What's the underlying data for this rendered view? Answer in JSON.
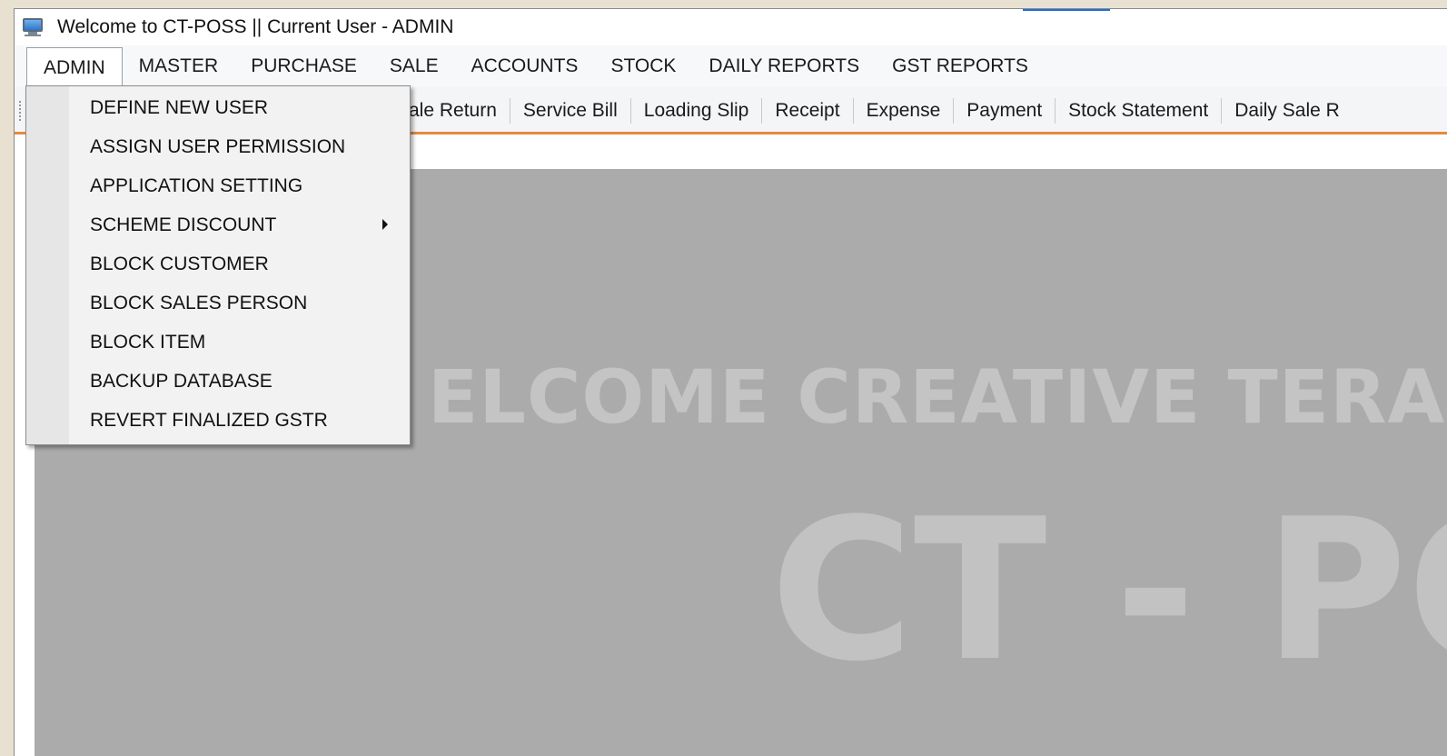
{
  "window": {
    "title": "Welcome to CT-POSS || Current User - ADMIN"
  },
  "menubar": {
    "items": [
      "ADMIN",
      "MASTER",
      "PURCHASE",
      "SALE",
      "ACCOUNTS",
      "STOCK",
      "DAILY REPORTS",
      "GST REPORTS"
    ],
    "active": "ADMIN"
  },
  "toolbar": {
    "items": [
      "ale Return",
      "Service Bill",
      "Loading Slip",
      "Receipt",
      "Expense",
      "Payment",
      "Stock Statement",
      "Daily Sale R"
    ]
  },
  "admin_menu": {
    "items": [
      "DEFINE NEW USER",
      "ASSIGN USER PERMISSION",
      "APPLICATION SETTING",
      "SCHEME DISCOUNT",
      "BLOCK CUSTOMER",
      "BLOCK SALES PERSON",
      "BLOCK ITEM",
      "BACKUP DATABASE",
      "REVERT FINALIZED GSTR"
    ]
  },
  "background": {
    "welcome": "ELCOME CREATIVE TERABITE S",
    "logo": "CT - PO"
  },
  "colors": {
    "accent_bar": "#e38a3f",
    "workspace": "#ababab",
    "watermark": "#c4c4c4"
  },
  "icons": {
    "app": "monitor-icon",
    "submenu": "chevron-right-icon"
  }
}
